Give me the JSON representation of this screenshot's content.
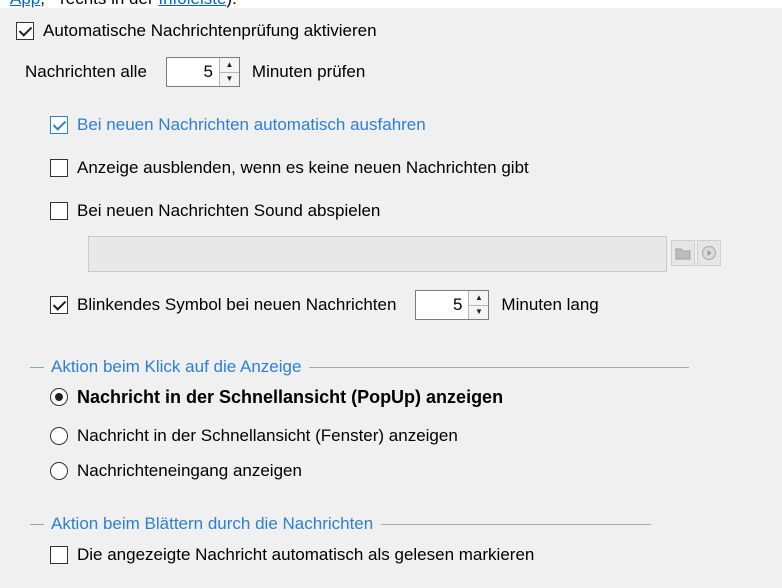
{
  "top_clip": {
    "prefix": "App",
    "middle": ", - rechts in der ",
    "link": "Infoleiste",
    "suffix": ")."
  },
  "auto_check": {
    "label": "Automatische Nachrichtenprüfung aktivieren",
    "checked": true
  },
  "interval": {
    "prefix": "Nachrichten alle",
    "value": "5",
    "suffix": "Minuten prüfen"
  },
  "auto_expand": {
    "label": "Bei neuen Nachrichten automatisch ausfahren",
    "checked": true
  },
  "hide_empty": {
    "label": "Anzeige ausblenden, wenn es keine neuen Nachrichten gibt",
    "checked": false
  },
  "play_sound": {
    "label": "Bei neuen Nachrichten Sound abspielen",
    "checked": false,
    "file_value": ""
  },
  "blink": {
    "label": "Blinkendes Symbol bei neuen Nachrichten",
    "value": "5",
    "suffix": "Minuten lang",
    "checked": true
  },
  "click_action": {
    "title": "Aktion beim Klick auf die Anzeige",
    "options": [
      {
        "label": "Nachricht in der Schnellansicht (PopUp) anzeigen",
        "selected": true
      },
      {
        "label": "Nachricht in der Schnellansicht (Fenster) anzeigen",
        "selected": false
      },
      {
        "label": "Nachrichteneingang anzeigen",
        "selected": false
      }
    ]
  },
  "scroll_action": {
    "title": "Aktion beim Blättern durch die Nachrichten",
    "mark_read": {
      "label": "Die angezeigte Nachricht automatisch als gelesen markieren",
      "checked": false
    }
  },
  "colors": {
    "accent": "#2b7fd9",
    "background": "#f0f0f0"
  }
}
